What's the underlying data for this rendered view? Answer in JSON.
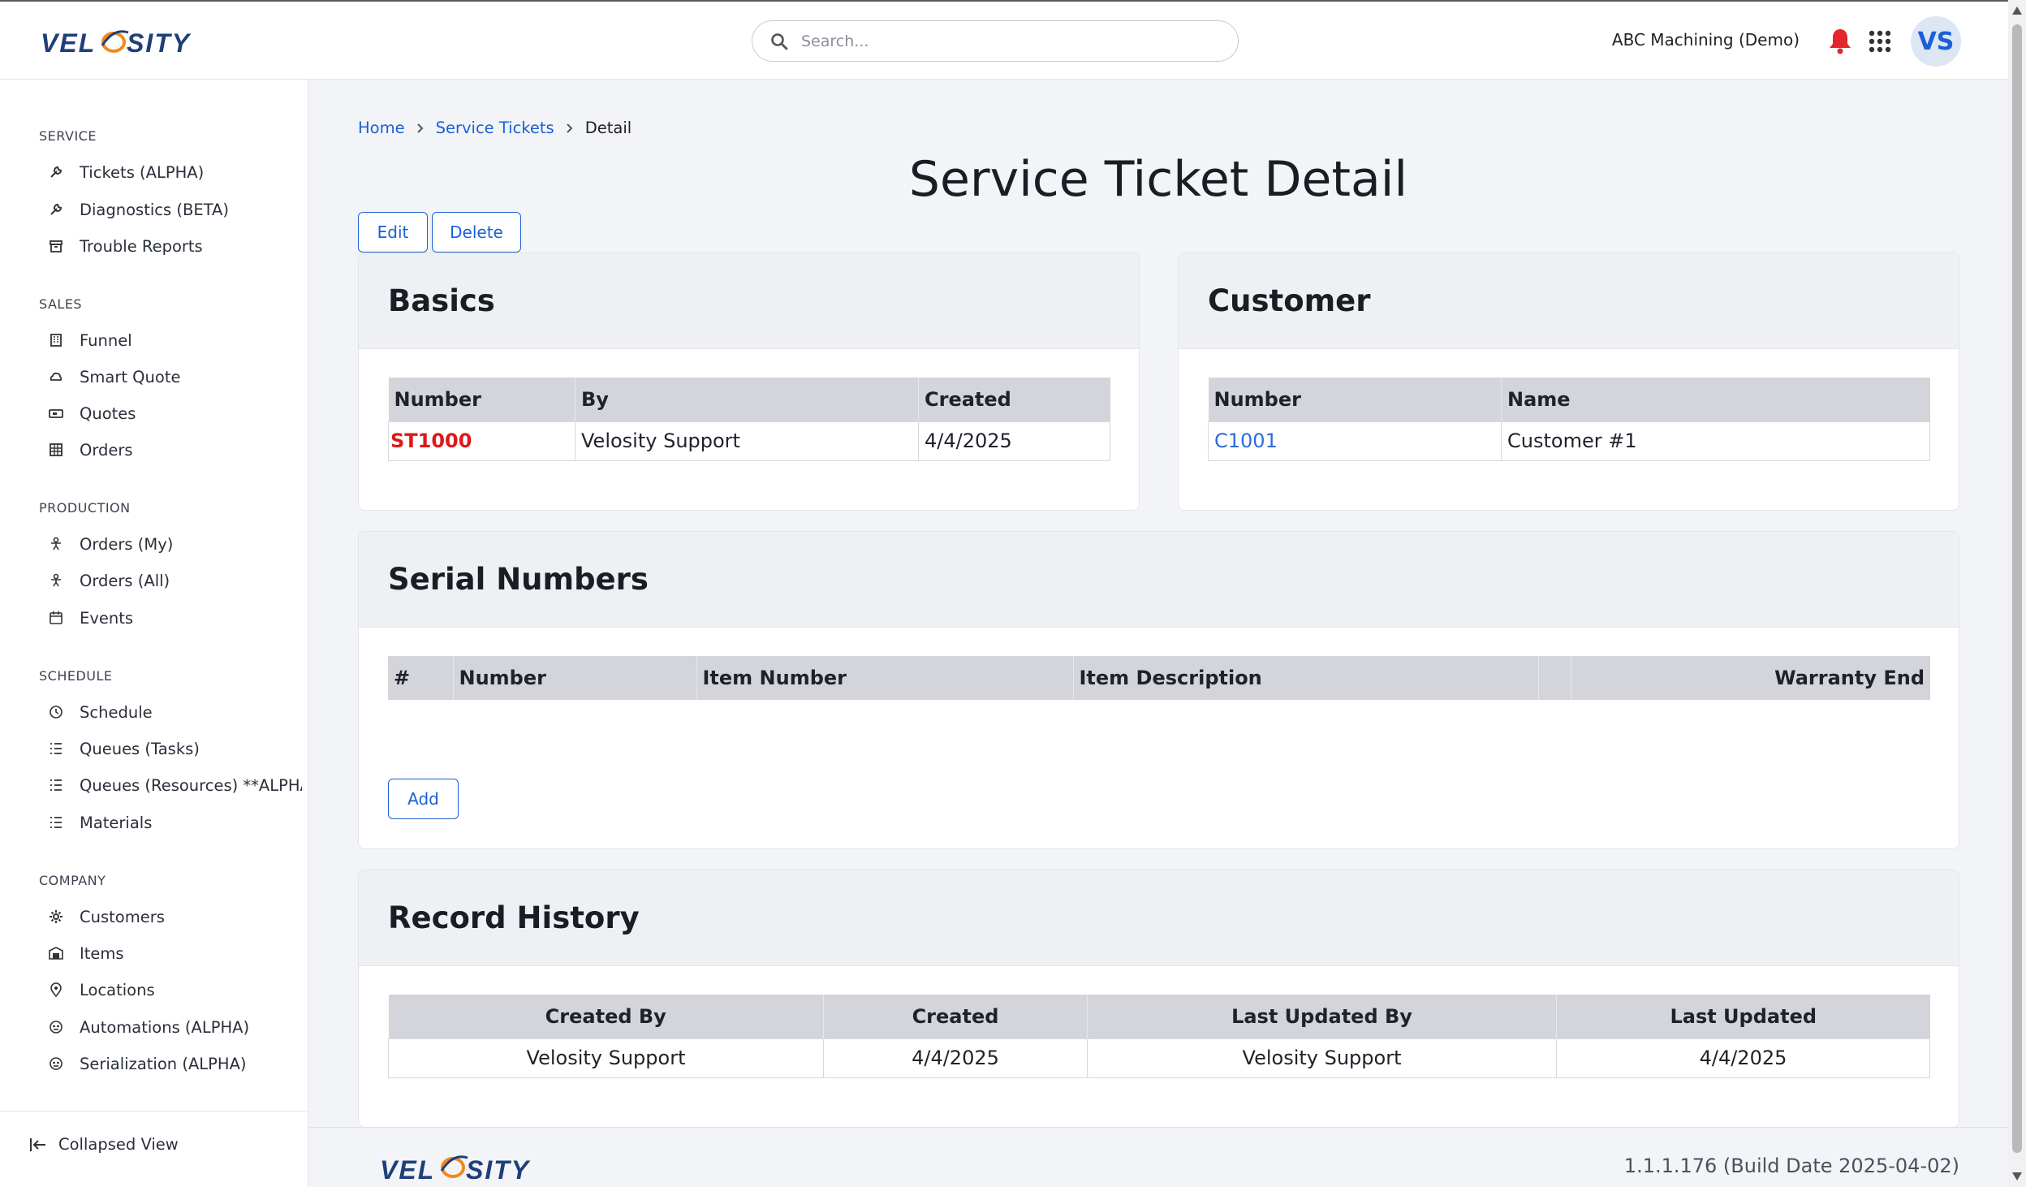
{
  "header": {
    "logo_text": "VELOSITY",
    "search_placeholder": "Search...",
    "company": "ABC Machining (Demo)",
    "avatar_initials": "VS"
  },
  "sidebar": {
    "sections": [
      {
        "title": "SERVICE",
        "items": [
          {
            "label": "Tickets (ALPHA)",
            "icon": "wrench-icon"
          },
          {
            "label": "Diagnostics (BETA)",
            "icon": "wrench-icon"
          },
          {
            "label": "Trouble Reports",
            "icon": "archive-icon"
          }
        ]
      },
      {
        "title": "SALES",
        "items": [
          {
            "label": "Funnel",
            "icon": "building-icon"
          },
          {
            "label": "Smart Quote",
            "icon": "cloud-icon"
          },
          {
            "label": "Quotes",
            "icon": "ticket-icon"
          },
          {
            "label": "Orders",
            "icon": "table-icon"
          }
        ]
      },
      {
        "title": "PRODUCTION",
        "items": [
          {
            "label": "Orders (My)",
            "icon": "person-icon"
          },
          {
            "label": "Orders (All)",
            "icon": "person-icon"
          },
          {
            "label": "Events",
            "icon": "calendar-icon"
          }
        ]
      },
      {
        "title": "SCHEDULE",
        "items": [
          {
            "label": "Schedule",
            "icon": "clock-icon"
          },
          {
            "label": "Queues (Tasks)",
            "icon": "list-icon"
          },
          {
            "label": "Queues (Resources) **ALPHA**",
            "icon": "list-icon"
          },
          {
            "label": "Materials",
            "icon": "list-icon"
          }
        ]
      },
      {
        "title": "COMPANY",
        "items": [
          {
            "label": "Customers",
            "icon": "gear-icon"
          },
          {
            "label": "Items",
            "icon": "warehouse-icon"
          },
          {
            "label": "Locations",
            "icon": "location-pin-icon"
          },
          {
            "label": "Automations (ALPHA)",
            "icon": "robot-icon"
          },
          {
            "label": "Serialization (ALPHA)",
            "icon": "robot-icon"
          }
        ]
      }
    ],
    "collapse_label": "Collapsed View"
  },
  "breadcrumb": {
    "home": "Home",
    "parent": "Service Tickets",
    "current": "Detail"
  },
  "page": {
    "title": "Service Ticket Detail",
    "edit_label": "Edit",
    "delete_label": "Delete"
  },
  "basics": {
    "title": "Basics",
    "headers": [
      "Number",
      "By",
      "Created"
    ],
    "row": [
      "ST1000",
      "Velosity Support",
      "4/4/2025"
    ]
  },
  "customer": {
    "title": "Customer",
    "headers": [
      "Number",
      "Name"
    ],
    "row": [
      "C1001",
      "Customer #1"
    ]
  },
  "serials": {
    "title": "Serial Numbers",
    "headers": [
      "#",
      "Number",
      "Item Number",
      "Item Description",
      "",
      "Warranty End"
    ],
    "add_label": "Add"
  },
  "history": {
    "title": "Record History",
    "headers": [
      "Created By",
      "Created",
      "Last Updated By",
      "Last Updated"
    ],
    "row": [
      "Velosity Support",
      "4/4/2025",
      "Velosity Support",
      "4/4/2025"
    ]
  },
  "footer": {
    "version": "1.1.1.176 (Build Date 2025-04-02)"
  },
  "colors": {
    "accent": "#1a5fd6",
    "ticket_number": "#e01818",
    "bell": "#e3262b"
  }
}
